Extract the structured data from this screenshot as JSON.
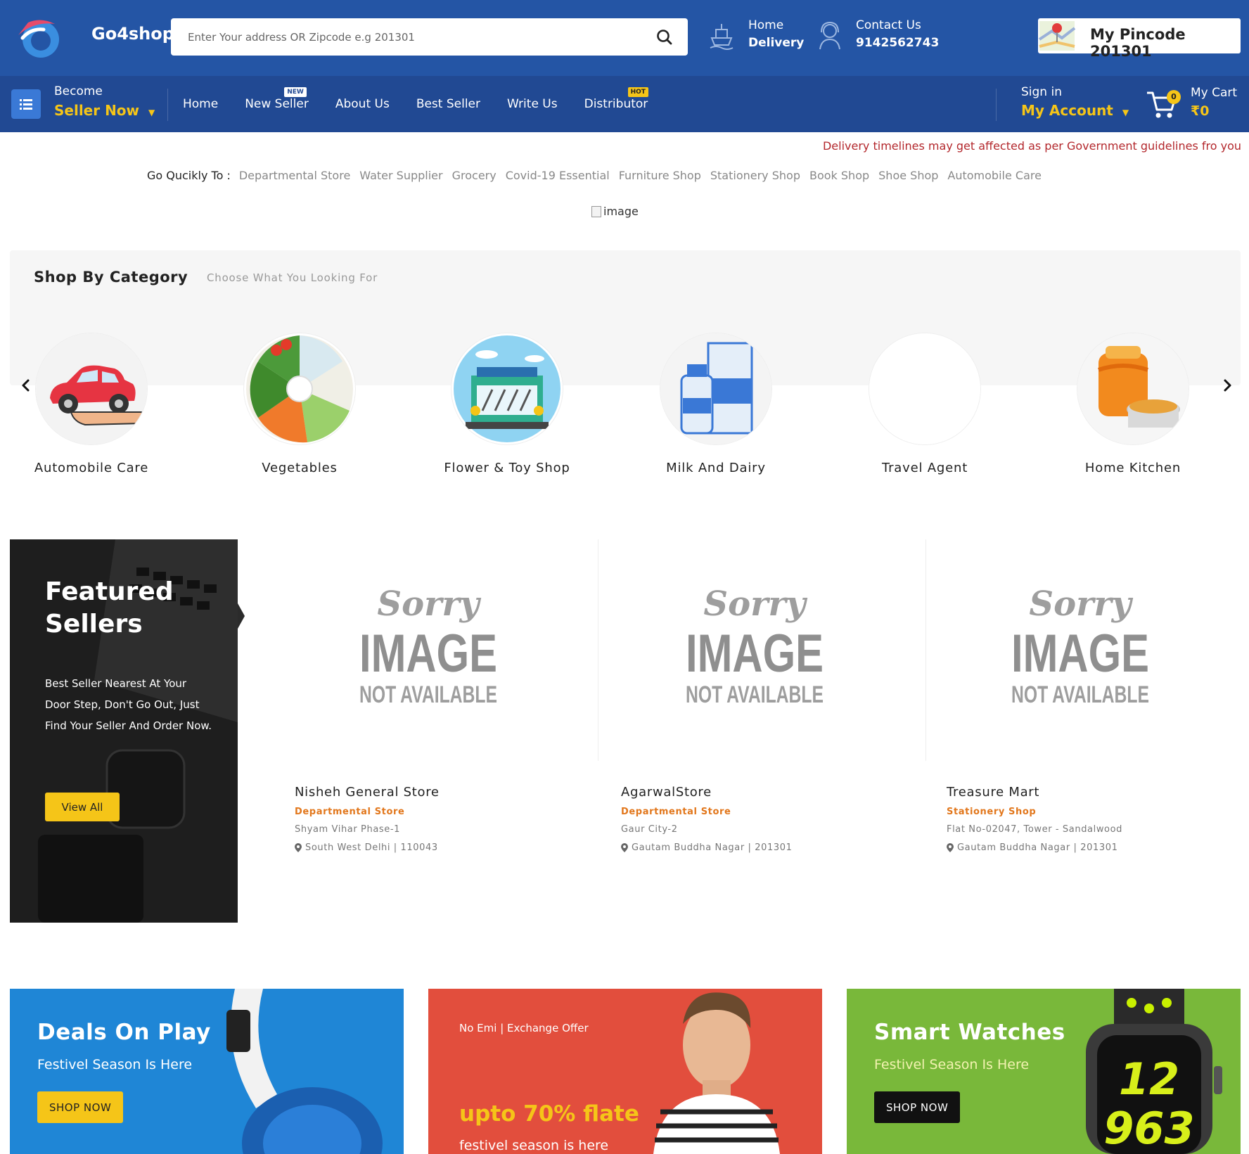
{
  "header": {
    "brand": "Go4shop",
    "search_placeholder": "Enter Your address OR Zipcode e.g 201301",
    "delivery_line1": "Home",
    "delivery_line2": "Delivery",
    "contact_line1": "Contact Us",
    "contact_line2": "9142562743",
    "pincode_label": "My Pincode 201301"
  },
  "nav": {
    "become": "Become",
    "seller_now": "Seller Now",
    "links": [
      {
        "label": "Home",
        "badge": ""
      },
      {
        "label": "New Seller",
        "badge": "NEW"
      },
      {
        "label": "About Us",
        "badge": ""
      },
      {
        "label": "Best Seller",
        "badge": ""
      },
      {
        "label": "Write Us",
        "badge": ""
      },
      {
        "label": "Distributor",
        "badge": "HOT"
      }
    ],
    "sign_in": "Sign in",
    "my_account": "My Account",
    "cart_count": "0",
    "cart_label": "My Cart",
    "cart_total": "₹0"
  },
  "notice": "Delivery timelines may get affected as per Government guidelines fro you",
  "quick": {
    "title": "Go Qucikly To :",
    "links": [
      "Departmental Store",
      "Water Supplier",
      "Grocery",
      "Covid-19 Essential",
      "Furniture Shop",
      "Stationery Shop",
      "Book Shop",
      "Shoe Shop",
      "Automobile Care"
    ]
  },
  "banner_alt": "image",
  "categories": {
    "title": "Shop By Category",
    "subtitle": "Choose What You Looking For",
    "items": [
      {
        "label": "Automobile Care",
        "icon": "car-icon"
      },
      {
        "label": "Vegetables",
        "icon": "vegetables-icon"
      },
      {
        "label": "Flower & Toy Shop",
        "icon": "toy-shop-icon"
      },
      {
        "label": "Milk And Dairy",
        "icon": "milk-icon"
      },
      {
        "label": "Travel Agent",
        "icon": "travel-icon"
      },
      {
        "label": "Home Kitchen",
        "icon": "kitchen-icon"
      }
    ]
  },
  "featured": {
    "title": "Featured Sellers",
    "text": "Best Seller Nearest At Your Door Step, Don't Go Out, Just Find Your Seller And Order Now.",
    "button": "View All",
    "sorry_line1": "Sorry",
    "sorry_line2": "IMAGE",
    "sorry_line3": "NOT AVAILABLE",
    "sellers": [
      {
        "name": "Nisheh General Store",
        "category": "Departmental Store",
        "address": "Shyam Vihar Phase-1",
        "location": "South West Delhi | 110043"
      },
      {
        "name": "AgarwalStore",
        "category": "Departmental Store",
        "address": "Gaur City-2",
        "location": "Gautam Buddha Nagar | 201301"
      },
      {
        "name": "Treasure Mart",
        "category": "Stationery Shop",
        "address": "Flat No-02047, Tower - Sandalwood",
        "location": "Gautam Buddha Nagar | 201301"
      }
    ]
  },
  "promos": [
    {
      "title": "Deals On Play",
      "subtitle": "Festivel Season Is Here",
      "button": "SHOP NOW",
      "color": "#1f86d6"
    },
    {
      "small": "No Emi | Exchange Offer",
      "big": "upto 70% flate",
      "subtitle": "festivel season is here",
      "color": "#e24e3d"
    },
    {
      "title": "Smart Watches",
      "subtitle": "Festivel Season Is Here",
      "button": "SHOP NOW",
      "color": "#79b83a"
    }
  ],
  "colors": {
    "header_bg": "#2455a5",
    "nav_bg": "#214993",
    "accent": "#f5c518",
    "notice": "#b3272c",
    "seller_category": "#e2771c"
  }
}
